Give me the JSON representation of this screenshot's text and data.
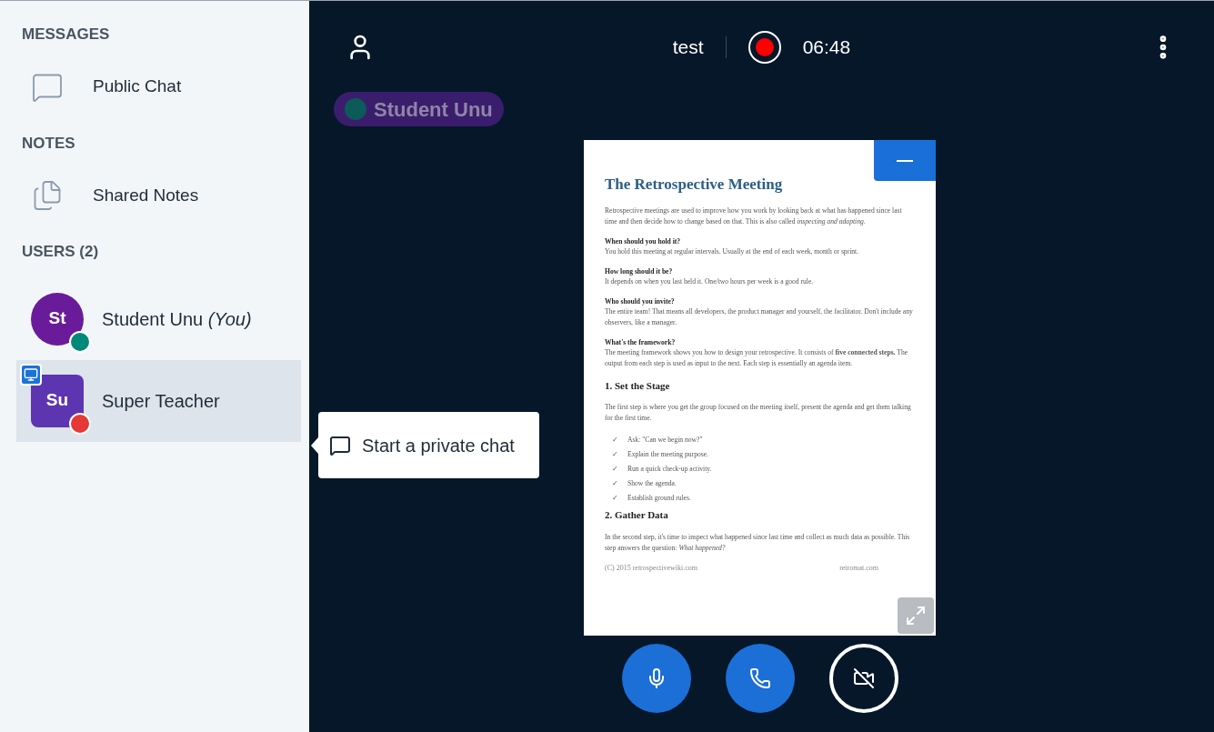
{
  "sidebar": {
    "sections": [
      {
        "heading": "MESSAGES",
        "items": [
          {
            "kind": "chat",
            "label": "Public Chat"
          }
        ]
      },
      {
        "heading": "NOTES",
        "items": [
          {
            "kind": "notes",
            "label": "Shared Notes"
          }
        ]
      }
    ],
    "users_heading": "USERS (2)",
    "users": [
      {
        "initials": "St",
        "name": "Student Unu",
        "suffix": "(You)",
        "kind": "viewer",
        "color": "#6a1b9a",
        "badge": {
          "color": "#00897b"
        },
        "presenter": false,
        "selected": false
      },
      {
        "initials": "Su",
        "name": "Super Teacher",
        "kind": "moderator",
        "color": "#5e35b1",
        "badge": {
          "color": "#e53935"
        },
        "presenter": true,
        "selected": true
      }
    ]
  },
  "tooltip": {
    "text": "Start a private chat"
  },
  "top_bar": {
    "title": "test",
    "recording": true,
    "timer": "06:48"
  },
  "talking": {
    "name": "Student Unu",
    "talking": false
  },
  "document": {
    "title": "The Retrospective Meeting",
    "blocks": [
      {
        "kind": "para",
        "text": "Retrospective meetings are used to improve how you work by looking back at what has happened since last time and then decide how to change based on that. This is also called *inspecting and adapting*."
      },
      {
        "kind": "question",
        "text": "When should you hold it?"
      },
      {
        "kind": "para",
        "text": "You hold this meeting at regular intervals. Usually at the end of each week, month or sprint."
      },
      {
        "kind": "question",
        "text": "How long should it be?"
      },
      {
        "kind": "para",
        "text": "It depends on when you last held it. One/two hours per week is a good rule."
      },
      {
        "kind": "question",
        "text": "Who should you invite?"
      },
      {
        "kind": "para",
        "text": "The entire team! That means all developers, the product manager and yourself, the facilitator. Don't include any observers, like a manager."
      },
      {
        "kind": "question",
        "text": "What's the framework?"
      },
      {
        "kind": "para",
        "text": "The meeting framework shows you how to design your retrospective. It consists of **five connected steps.** The output from each step is used as input to the next. Each step is essentially an agenda item."
      },
      {
        "kind": "heading",
        "text": "1. Set the Stage"
      },
      {
        "kind": "para",
        "text": "The first step is where you get the group focused on the meeting itself, present the agenda and get them talking for the first time."
      },
      {
        "kind": "check",
        "mark": "✓",
        "text": "Ask: \"Can we begin now?\""
      },
      {
        "kind": "check",
        "mark": "✓",
        "text": "Explain the meeting purpose."
      },
      {
        "kind": "check",
        "mark": "✓",
        "text": "Run a quick check-up activity."
      },
      {
        "kind": "check",
        "mark": "✓",
        "text": "Show the agenda."
      },
      {
        "kind": "check",
        "mark": "✓",
        "text": "Establish ground rules."
      },
      {
        "kind": "heading",
        "text": "2. Gather Data"
      },
      {
        "kind": "para",
        "text": "In the second step, it's time to inspect what happened since last time and collect as much data as possible. This step answers the question: *What happened?*"
      }
    ],
    "footer_left": "(C) 2015 retrospectivewiki.com",
    "footer_right": "retromat.com"
  },
  "controls": [
    {
      "kind": "mic",
      "active": true
    },
    {
      "kind": "phone",
      "active": true
    },
    {
      "kind": "video",
      "active": false
    }
  ]
}
